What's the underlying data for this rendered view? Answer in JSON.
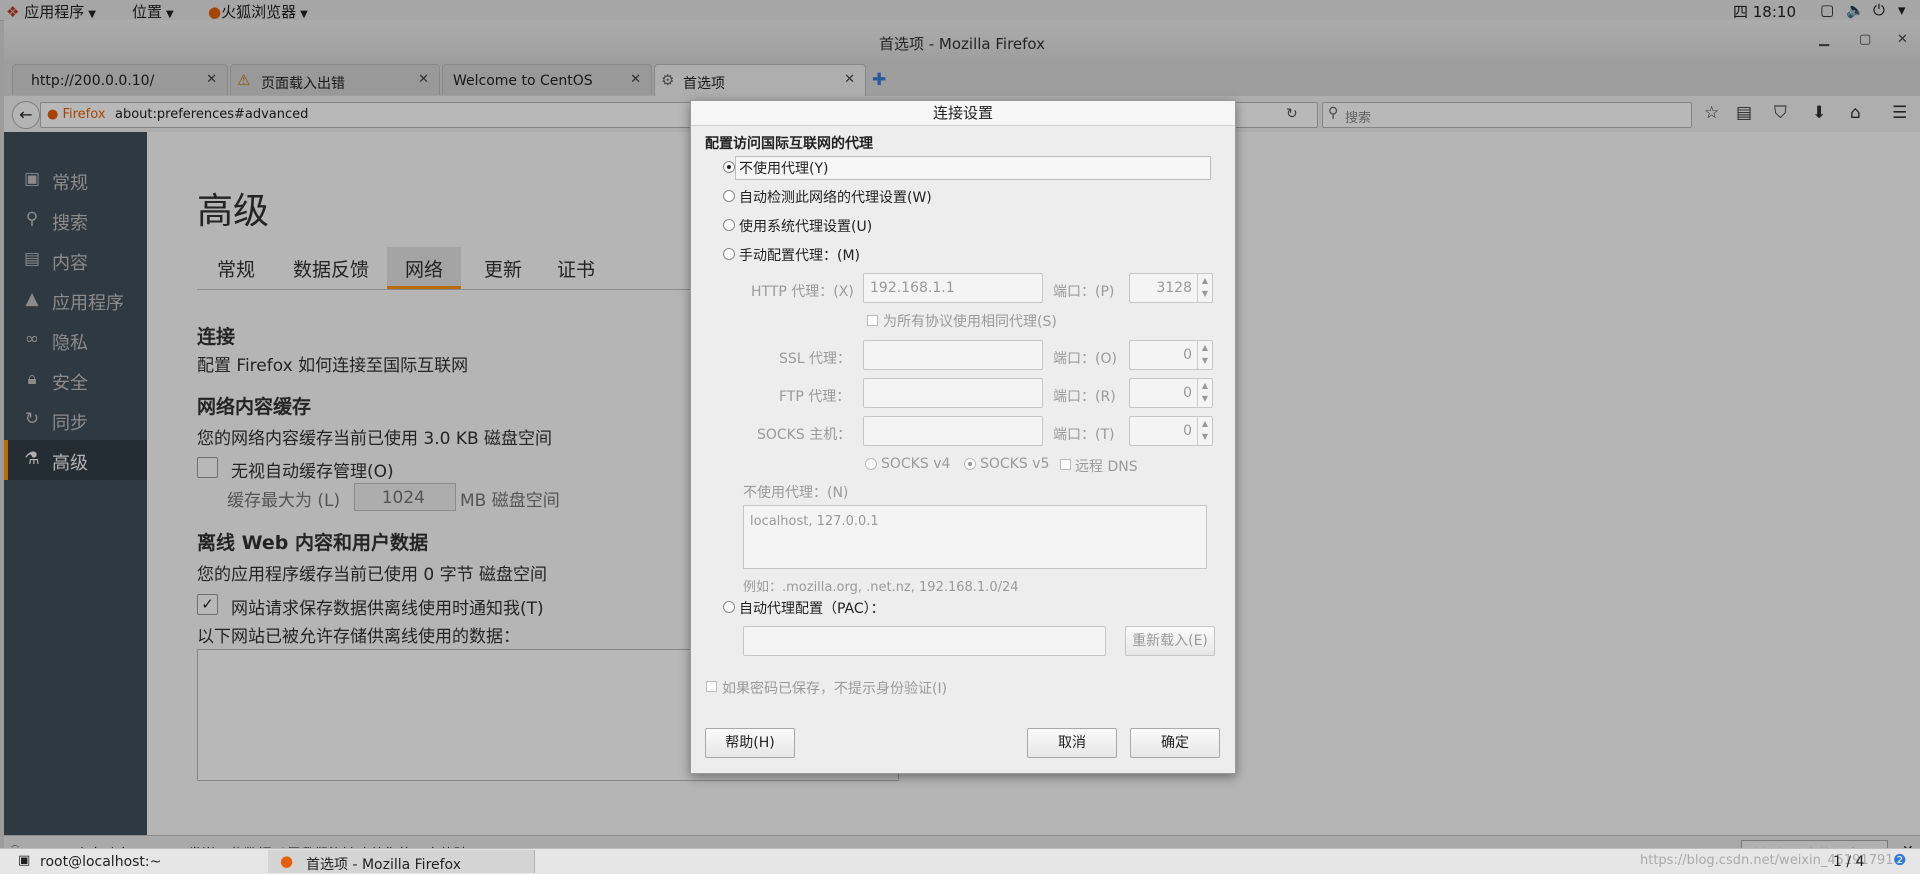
{
  "topbar": {
    "apps_label": "应用程序",
    "places_label": "位置",
    "browser_label": "火狐浏览器",
    "clock": "四 18:10"
  },
  "window": {
    "title": "首选项 - Mozilla Firefox"
  },
  "tabs": [
    {
      "label": "http://200.0.0.10/",
      "icon": "none"
    },
    {
      "label": "页面载入出错",
      "icon": "warning-icon"
    },
    {
      "label": "Welcome to CentOS",
      "icon": "none"
    },
    {
      "label": "首选项",
      "icon": "gear-icon",
      "active": true
    }
  ],
  "navbar": {
    "identity_label": "Firefox",
    "url": "about:preferences#advanced",
    "search_placeholder": "搜索"
  },
  "sidebar": {
    "items": [
      {
        "label": "常规",
        "icon": "general-icon"
      },
      {
        "label": "搜索",
        "icon": "search-icon"
      },
      {
        "label": "内容",
        "icon": "content-icon"
      },
      {
        "label": "应用程序",
        "icon": "rocket-icon"
      },
      {
        "label": "隐私",
        "icon": "mask-icon"
      },
      {
        "label": "安全",
        "icon": "lock-icon"
      },
      {
        "label": "同步",
        "icon": "sync-icon"
      },
      {
        "label": "高级",
        "icon": "wizard-icon",
        "active": true
      }
    ]
  },
  "prefs": {
    "title": "高级",
    "subtabs": [
      "常规",
      "数据反馈",
      "网络",
      "更新",
      "证书"
    ],
    "active_subtab": "网络",
    "connection_heading": "连接",
    "connection_desc": "配置 Firefox 如何连接至国际互联网",
    "cache_heading": "网络内容缓存",
    "cache_desc": "您的网络内容缓存当前已使用 3.0 KB 磁盘空间",
    "cache_override_label": "无视自动缓存管理(O)",
    "cache_limit_label": "缓存最大为 (L)",
    "cache_limit_value": "1024",
    "cache_limit_unit": "MB 磁盘空间",
    "offline_heading": "离线 Web 内容和用户数据",
    "offline_desc": "您的应用程序缓存当前已使用 0 字节 磁盘空间",
    "offline_notify_label": "网站请求保存数据供离线使用时通知我(T)",
    "offline_allowed_label": "以下网站已被允许存储供离线使用的数据："
  },
  "dialog": {
    "title": "连接设置",
    "heading": "配置访问国际互联网的代理",
    "options": {
      "no_proxy": "不使用代理(Y)",
      "auto_detect": "自动检测此网络的代理设置(W)",
      "system": "使用系统代理设置(U)",
      "manual": "手动配置代理：(M)",
      "pac": "自动代理配置（PAC）："
    },
    "selected_option": "no_proxy",
    "http_label": "HTTP 代理：(X)",
    "http_value": "192.168.1.1",
    "http_port_label": "端口：(P)",
    "http_port_value": "3128",
    "same_proxy_label": "为所有协议使用相同代理(S)",
    "ssl_label": "SSL 代理：",
    "ssl_port_label": "端口：(O)",
    "ssl_port_value": "0",
    "ftp_label": "FTP 代理：",
    "ftp_port_label": "端口：(R)",
    "ftp_port_value": "0",
    "socks_label": "SOCKS 主机：",
    "socks_port_label": "端口：(T)",
    "socks_port_value": "0",
    "socks_v4": "SOCKS v4",
    "socks_v5": "SOCKS v5",
    "remote_dns": "远程 DNS",
    "no_proxy_for_label": "不使用代理：(N)",
    "no_proxy_for_value": "localhost, 127.0.0.1",
    "example": "例如：.mozilla.org, .net.nz, 192.168.1.0/24",
    "reload_button": "重新载入(E)",
    "no_auth_prompt": "如果密码已保存，不提示身份验证(I)",
    "help_button": "帮助(H)",
    "cancel_button": "取消",
    "ok_button": "确定"
  },
  "notification": {
    "text": "Firefox 会自动向 Mozilla 发送一些数据以便我们能够改善您的用户体验。",
    "button": "选择想分享的信息(C)"
  },
  "taskbar": {
    "items": [
      "root@localhost:~",
      "首选项 - Mozilla Firefox"
    ],
    "workspace": "1 / 4",
    "watermark": "https://blog.csdn.net/weixin_45191791"
  },
  "colors": {
    "accent": "#ff9500",
    "sidebar_bg": "#424f5a",
    "firefox_orange": "#e66000"
  }
}
